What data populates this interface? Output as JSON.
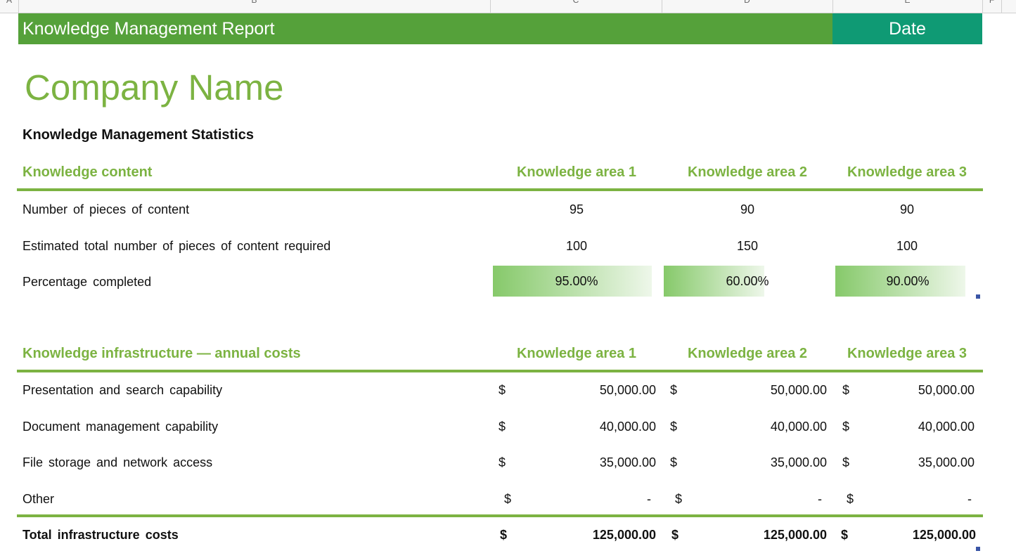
{
  "columns": [
    "A",
    "B",
    "C",
    "D",
    "E",
    "F"
  ],
  "report": {
    "title": "Knowledge Management Report",
    "date_label": "Date",
    "company": "Company Name",
    "stats_title": "Knowledge Management Statistics"
  },
  "content_table": {
    "header": "Knowledge content",
    "areas": [
      "Knowledge area 1",
      "Knowledge area 2",
      "Knowledge area 3"
    ],
    "rows": [
      {
        "label": "Number of pieces of content",
        "values": [
          "95",
          "90",
          "90"
        ]
      },
      {
        "label": "Estimated total number of pieces of content required",
        "values": [
          "100",
          "150",
          "100"
        ]
      }
    ],
    "percent_row": {
      "label": "Percentage completed",
      "values": [
        "95.00%",
        "60.00%",
        "90.00%"
      ],
      "fractions": [
        0.95,
        0.6,
        0.9
      ]
    }
  },
  "cost_table": {
    "header": "Knowledge infrastructure — annual costs",
    "areas": [
      "Knowledge area 1",
      "Knowledge area 2",
      "Knowledge area 3"
    ],
    "currency": "$",
    "rows": [
      {
        "label": "Presentation and search capability",
        "values": [
          "50,000.00",
          "50,000.00",
          "50,000.00"
        ]
      },
      {
        "label": "Document management capability",
        "values": [
          "40,000.00",
          "40,000.00",
          "40,000.00"
        ]
      },
      {
        "label": "File storage and network access",
        "values": [
          "35,000.00",
          "35,000.00",
          "35,000.00"
        ]
      },
      {
        "label": "Other",
        "values": [
          "-",
          "-",
          "-"
        ]
      }
    ],
    "total": {
      "label": "Total infrastructure costs",
      "values": [
        "125,000.00",
        "125,000.00",
        "125,000.00"
      ]
    }
  },
  "colors": {
    "title_bar": "#55a13a",
    "date_bar": "#0f9a74",
    "accent_green": "#7cb342",
    "data_bar_start": "#86c96a",
    "selection_handle": "#3a55a6"
  }
}
